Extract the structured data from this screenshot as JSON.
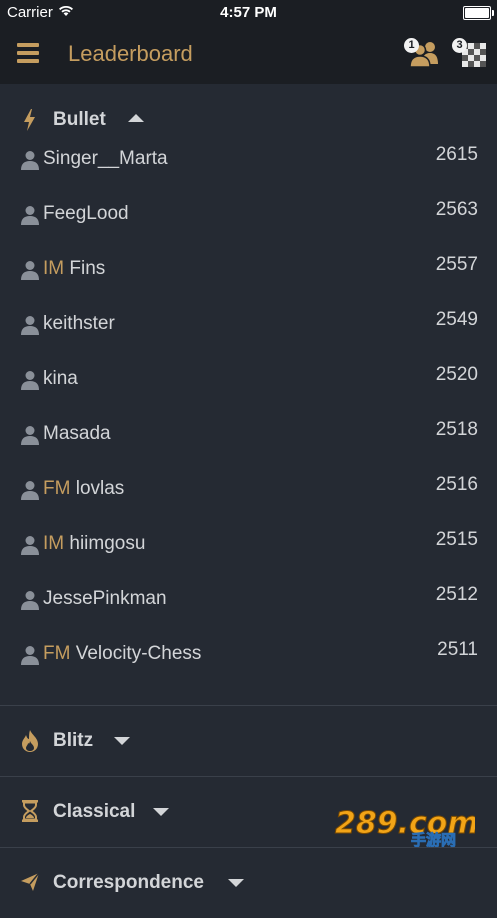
{
  "status_bar": {
    "carrier": "Carrier",
    "time": "4:57 PM"
  },
  "header": {
    "title": "Leaderboard",
    "friends_badge": "1",
    "games_badge": "3"
  },
  "sections": {
    "bullet": {
      "label": "Bullet",
      "players": [
        {
          "title": "",
          "name": "Singer__Marta",
          "rating": "2615"
        },
        {
          "title": "",
          "name": "FeegLood",
          "rating": "2563"
        },
        {
          "title": "IM",
          "name": "Fins",
          "rating": "2557"
        },
        {
          "title": "",
          "name": "keithster",
          "rating": "2549"
        },
        {
          "title": "",
          "name": "kina",
          "rating": "2520"
        },
        {
          "title": "",
          "name": "Masada",
          "rating": "2518"
        },
        {
          "title": "FM",
          "name": "lovlas",
          "rating": "2516"
        },
        {
          "title": "IM",
          "name": "hiimgosu",
          "rating": "2515"
        },
        {
          "title": "",
          "name": "JessePinkman",
          "rating": "2512"
        },
        {
          "title": "FM",
          "name": "Velocity-Chess",
          "rating": "2511"
        }
      ]
    },
    "blitz": {
      "label": "Blitz"
    },
    "classical": {
      "label": "Classical"
    },
    "correspondence": {
      "label": "Correspondence"
    }
  },
  "watermark": {
    "main": "289.com",
    "sub": "手游网"
  },
  "colors": {
    "accent": "#c59d5f",
    "background": "#252a33",
    "header_bg": "#1b1e23",
    "text": "#d3d5d8"
  }
}
